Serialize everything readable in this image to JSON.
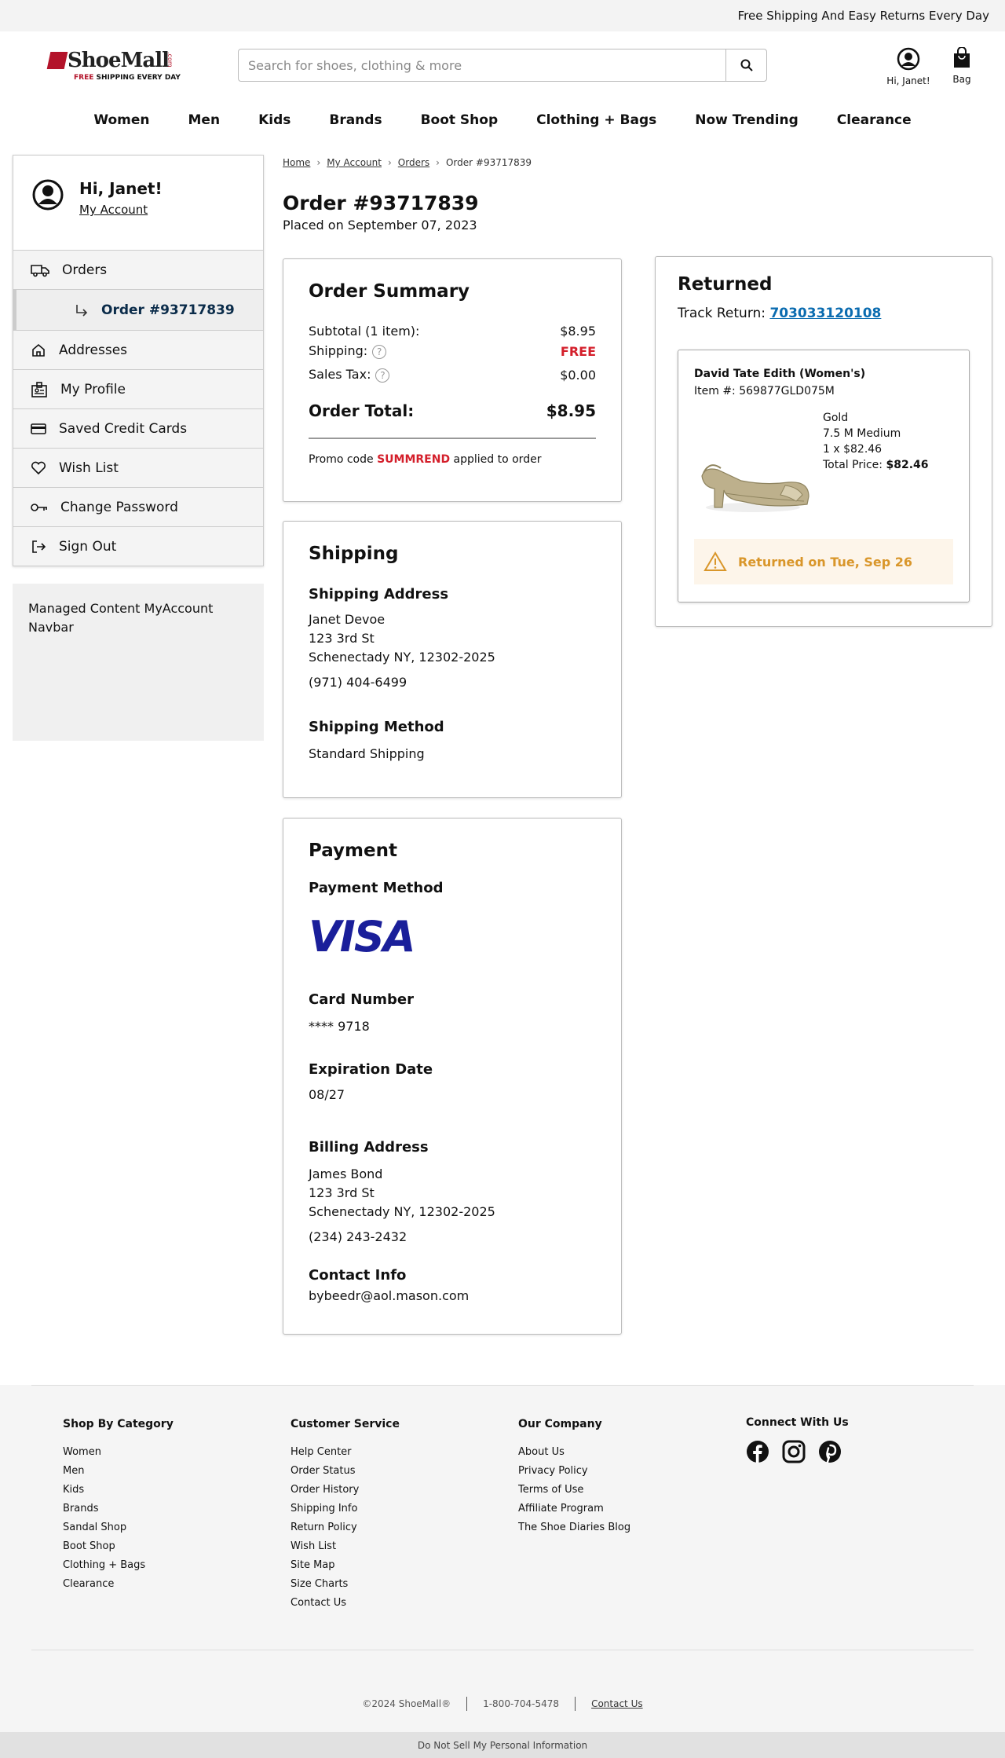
{
  "promo": {
    "text": "Free Shipping And Easy Returns Every Day"
  },
  "logo": {
    "name": "ShoeMall",
    "dotcom": ".com",
    "tag_free": "FREE",
    "tag_rest": " SHIPPING EVERY DAY",
    "brand_color": "#b3132a"
  },
  "search": {
    "placeholder": "Search for shoes, clothing & more"
  },
  "header": {
    "account_label": "Hi, Janet!",
    "bag_label": "Bag"
  },
  "nav": [
    "Women",
    "Men",
    "Kids",
    "Brands",
    "Boot Shop",
    "Clothing + Bags",
    "Now Trending",
    "Clearance"
  ],
  "sidebar": {
    "greeting": "Hi, Janet!",
    "my_account": "My Account",
    "items": {
      "orders": "Orders",
      "order_sub": "Order #93717839",
      "addresses": "Addresses",
      "profile": "My Profile",
      "cards": "Saved Credit Cards",
      "wishlist": "Wish List",
      "password": "Change Password",
      "signout": "Sign Out"
    },
    "managed": "Managed Content MyAccount Navbar"
  },
  "breadcrumb": {
    "home": "Home",
    "account": "My Account",
    "orders": "Orders",
    "current": "Order #93717839"
  },
  "order": {
    "title": "Order #93717839",
    "placed": "Placed on September 07, 2023"
  },
  "summary": {
    "heading": "Order Summary",
    "subtotal_label": "Subtotal (1 item):",
    "subtotal": "$8.95",
    "shipping_label": "Shipping:",
    "shipping": "FREE",
    "tax_label": "Sales Tax:",
    "tax": "$0.00",
    "total_label": "Order Total:",
    "total": "$8.95",
    "promo_pre": "Promo code ",
    "promo_code": "SUMMREND",
    "promo_post": " applied to order"
  },
  "shipping": {
    "heading": "Shipping",
    "address_h": "Shipping Address",
    "name": "Janet Devoe",
    "street": "123 3rd St",
    "city": "Schenectady NY, 12302-2025",
    "phone": "(971) 404-6499",
    "method_h": "Shipping Method",
    "method": "Standard Shipping"
  },
  "payment": {
    "heading": "Payment",
    "method_h": "Payment Method",
    "card_brand": "VISA",
    "card_h": "Card Number",
    "card": "**** 9718",
    "exp_h": "Expiration Date",
    "exp": "08/27",
    "billing_h": "Billing Address",
    "name": "James Bond",
    "street": "123 3rd St",
    "city": "Schenectady NY, 12302-2025",
    "phone": "(234) 243-2432",
    "contact_h": "Contact Info",
    "email": "bybeedr@aol.mason.com"
  },
  "returned": {
    "heading": "Returned",
    "track_label": "Track Return: ",
    "track_number": "703033120108",
    "product": "David Tate Edith (Women's)",
    "item_no": "Item #: 569877GLD075M",
    "color": "Gold",
    "size": "7.5 M Medium",
    "qty": "1 x $82.46",
    "total_label": "Total Price: ",
    "total": "$82.46",
    "status": "Returned on Tue, Sep 26"
  },
  "footer": {
    "shop": {
      "heading": "Shop By Category",
      "links": [
        "Women",
        "Men",
        "Kids",
        "Brands",
        "Sandal Shop",
        "Boot Shop",
        "Clothing + Bags",
        "Clearance"
      ]
    },
    "service": {
      "heading": "Customer Service",
      "links": [
        "Help Center",
        "Order Status",
        "Order History",
        "Shipping Info",
        "Return Policy",
        "Wish List",
        "Site Map",
        "Size Charts",
        "Contact Us"
      ]
    },
    "company": {
      "heading": "Our Company",
      "links": [
        "About Us",
        "Privacy Policy",
        "Terms of Use",
        "Affiliate Program",
        "The Shoe Diaries Blog"
      ]
    },
    "connect": {
      "heading": "Connect With Us",
      "icons": [
        "facebook-icon",
        "instagram-icon",
        "pinterest-icon"
      ]
    },
    "copyright": "©2024 ShoeMall®",
    "phone": "1-800-704-5478",
    "contact": "Contact Us",
    "dns": "Do Not Sell My Personal Information"
  }
}
